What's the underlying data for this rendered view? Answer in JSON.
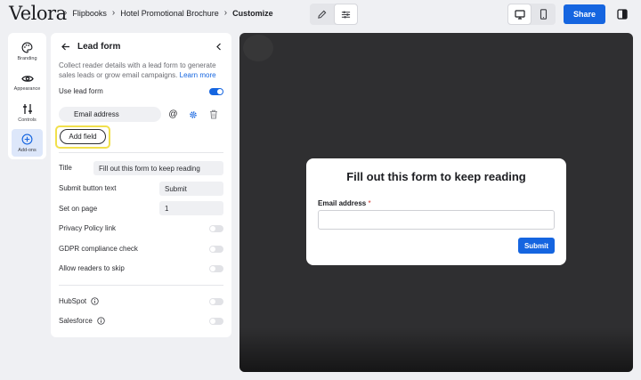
{
  "header": {
    "logo": "Velora",
    "breadcrumbs": [
      "Flipbooks",
      "Hotel Promotional Brochure",
      "Customize"
    ],
    "share_label": "Share"
  },
  "sidebar": {
    "items": [
      {
        "label": "Branding",
        "icon": "palette-icon"
      },
      {
        "label": "Appearance",
        "icon": "eye-icon"
      },
      {
        "label": "Controls",
        "icon": "sliders-icon"
      },
      {
        "label": "Add-ons",
        "icon": "plus-circle-icon"
      }
    ]
  },
  "panel": {
    "title": "Lead form",
    "description": "Collect reader details with a lead form to generate sales leads or grow email campaigns.",
    "learn_more": "Learn more",
    "use_lead_form_label": "Use lead form",
    "use_lead_form_on": true,
    "field_name": "Email address",
    "add_field_label": "Add field",
    "title_label": "Title",
    "title_value": "Fill out this form to keep reading",
    "submit_label": "Submit button text",
    "submit_value": "Submit",
    "page_label": "Set on page",
    "page_value": "1",
    "privacy_label": "Privacy Policy link",
    "gdpr_label": "GDPR compliance check",
    "skip_label": "Allow readers to skip",
    "hubspot_label": "HubSpot",
    "salesforce_label": "Salesforce"
  },
  "modal": {
    "title": "Fill out this form to keep reading",
    "field_label": "Email address",
    "required_mark": "*",
    "submit_label": "Submit"
  },
  "colors": {
    "accent": "#1565e0",
    "highlight": "#f1e04b"
  }
}
